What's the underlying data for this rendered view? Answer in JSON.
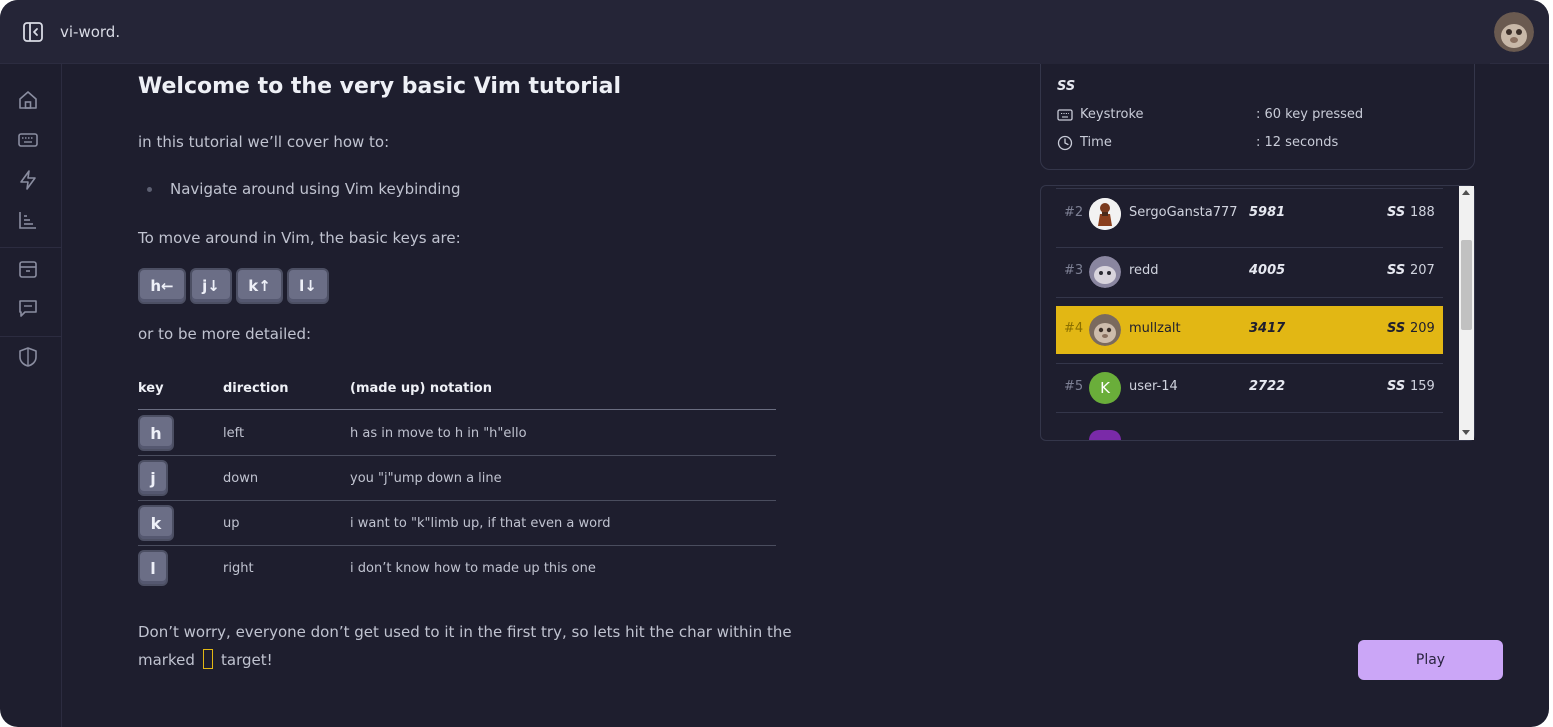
{
  "app": {
    "title": "vi-word."
  },
  "sidebar": {
    "items": [
      {
        "name": "home-icon"
      },
      {
        "name": "keyboard-icon"
      },
      {
        "name": "lightning-icon"
      },
      {
        "name": "chart-icon"
      },
      {
        "name": "inbox-icon"
      },
      {
        "name": "feedback-icon"
      },
      {
        "name": "shield-icon"
      }
    ]
  },
  "tutorial": {
    "title": "Welcome to the very basic Vim tutorial",
    "intro": "in this tutorial we’ll cover how to:",
    "bullets": [
      "Navigate around using Vim keybinding"
    ],
    "keys_intro": "To move around in Vim, the basic keys are:",
    "keycaps": [
      "h←",
      "j↓",
      "k↑",
      "l↓"
    ],
    "detailed_intro": "or to be more detailed:",
    "table": {
      "headers": [
        "key",
        "direction",
        "(made up) notation"
      ],
      "rows": [
        {
          "key": "h",
          "direction": "left",
          "notation": "h as in move to h in \"h\"ello"
        },
        {
          "key": "j",
          "direction": "down",
          "notation": "you \"j\"ump down a line"
        },
        {
          "key": "k",
          "direction": "up",
          "notation": "i want to \"k\"limb up, if that even a word"
        },
        {
          "key": "l",
          "direction": "right",
          "notation": "i don’t know how to made up this one"
        }
      ]
    },
    "outro_line1": "Don’t worry, everyone don’t get used to it in the first try, so lets hit the char within the",
    "outro_marked": "marked",
    "outro_target": "target!"
  },
  "stats": {
    "ss_label": "SS",
    "keystroke_label": "Keystroke",
    "keystroke_value": ": 60 key pressed",
    "time_label": "Time",
    "time_value": ": 12 seconds"
  },
  "leaderboard": {
    "rows": [
      {
        "rank": "#2",
        "name": "SergoGansta777",
        "score": "5981",
        "ss": "SS",
        "count": "188"
      },
      {
        "rank": "#3",
        "name": "redd",
        "score": "4005",
        "ss": "SS",
        "count": "207"
      },
      {
        "rank": "#4",
        "name": "mullzalt",
        "score": "3417",
        "ss": "SS",
        "count": "209"
      },
      {
        "rank": "#5",
        "name": "user-14",
        "avatar_letter": "K",
        "score": "2722",
        "ss": "SS",
        "count": "159"
      }
    ],
    "highlight_color": "#e2b714"
  },
  "actions": {
    "play_label": "Play"
  },
  "colors": {
    "accent": "#cba6f7",
    "highlight": "#e2b714",
    "background": "#1e1e2e"
  }
}
